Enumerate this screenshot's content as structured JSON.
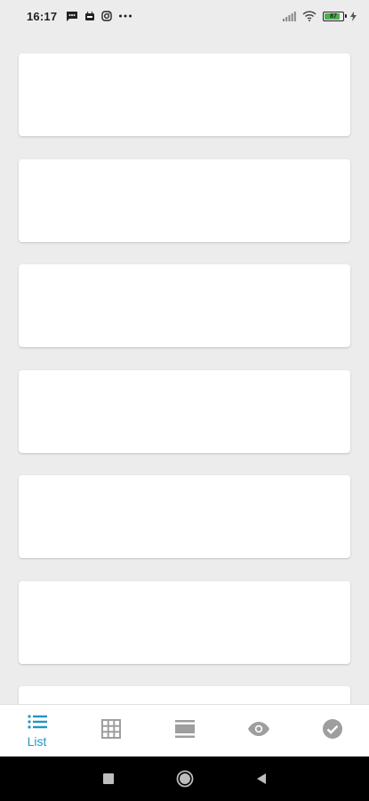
{
  "status_bar": {
    "time": "16:17",
    "battery_level": "87",
    "battery_fraction": 0.87,
    "left_icons": [
      "message-icon",
      "notification-app-icon",
      "instagram-icon",
      "more-dots-icon"
    ],
    "right_icons": [
      "signal-icon",
      "wifi-icon",
      "battery-icon",
      "charging-icon"
    ]
  },
  "content": {
    "cards": [
      {
        "id": 1
      },
      {
        "id": 2
      },
      {
        "id": 3
      },
      {
        "id": 4
      },
      {
        "id": 5
      },
      {
        "id": 6
      },
      {
        "id": 7
      }
    ]
  },
  "bottom_nav": {
    "active_color": "#2196c4",
    "inactive_color": "#9e9e9e",
    "items": [
      {
        "name": "list",
        "icon": "list-icon",
        "label": "List",
        "active": true
      },
      {
        "name": "grid",
        "icon": "grid-icon",
        "label": "",
        "active": false
      },
      {
        "name": "rows",
        "icon": "rows-icon",
        "label": "",
        "active": false
      },
      {
        "name": "eye",
        "icon": "eye-icon",
        "label": "",
        "active": false
      },
      {
        "name": "check",
        "icon": "check-circle-icon",
        "label": "",
        "active": false
      }
    ]
  },
  "system_nav": {
    "buttons": [
      "recents-icon",
      "home-icon",
      "back-icon"
    ]
  }
}
